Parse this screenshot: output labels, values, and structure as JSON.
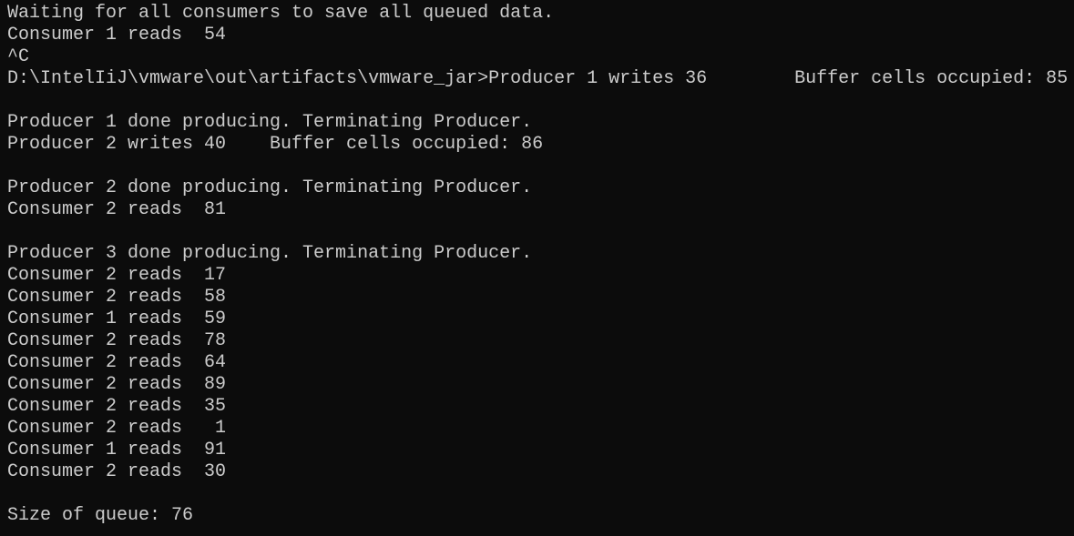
{
  "terminal": {
    "lines": [
      "Waiting for all consumers to save all queued data.",
      "Consumer 1 reads  54",
      "^C",
      "D:\\IntelIiJ\\vmware\\out\\artifacts\\vmware_jar>Producer 1 writes 36        Buffer cells occupied: 85",
      "",
      "Producer 1 done producing. Terminating Producer.",
      "Producer 2 writes 40    Buffer cells occupied: 86",
      "",
      "Producer 2 done producing. Terminating Producer.",
      "Consumer 2 reads  81",
      "",
      "Producer 3 done producing. Terminating Producer.",
      "Consumer 2 reads  17",
      "Consumer 2 reads  58",
      "Consumer 1 reads  59",
      "Consumer 2 reads  78",
      "Consumer 2 reads  64",
      "Consumer 2 reads  89",
      "Consumer 2 reads  35",
      "Consumer 2 reads   1",
      "Consumer 1 reads  91",
      "Consumer 2 reads  30",
      "",
      "Size of queue: 76"
    ]
  }
}
